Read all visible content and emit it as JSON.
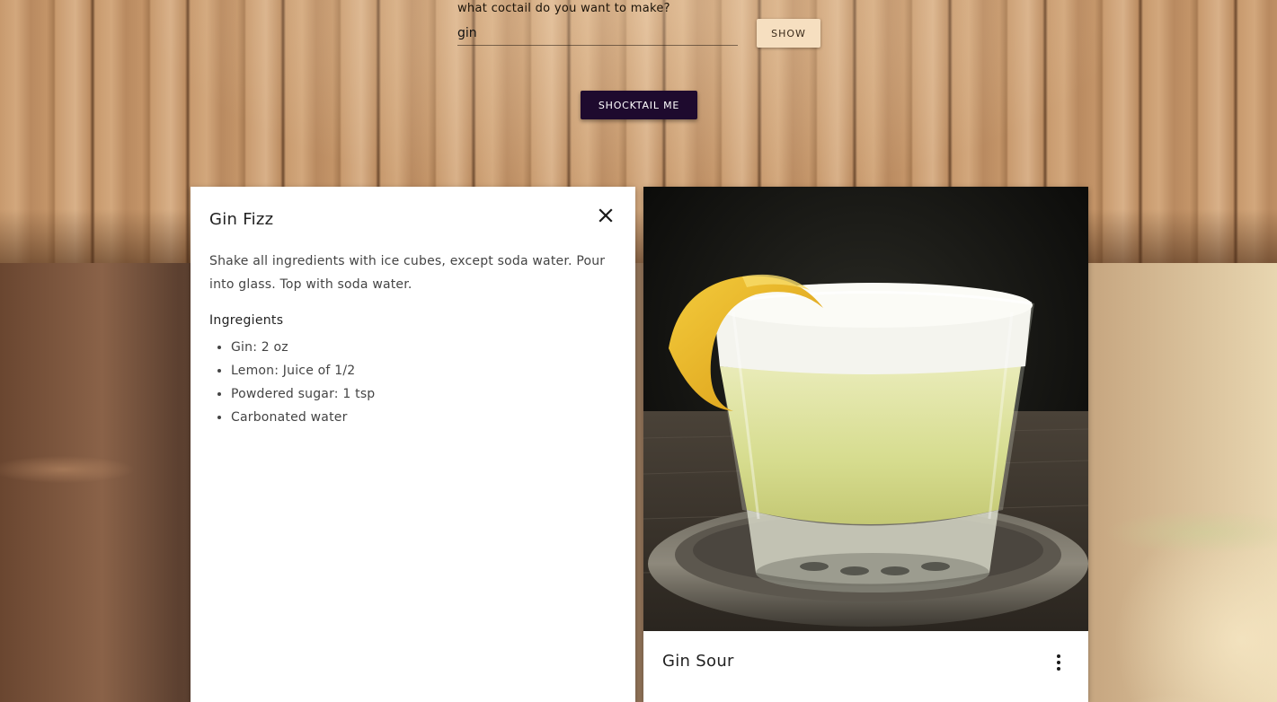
{
  "search": {
    "label": "what coctail do you want to make?",
    "value": "gin",
    "show_label": "Show"
  },
  "actions": {
    "shock_label": "Shocktail me"
  },
  "recipe_card": {
    "title": "Gin Fizz",
    "instructions": "Shake all ingredients with ice cubes, except soda water. Pour into glass. Top with soda water.",
    "ingredients_heading": "Ingregients",
    "ingredients": [
      "Gin: 2 oz",
      "Lemon: Juice of 1/2",
      "Powdered sugar: 1 tsp",
      "Carbonated water"
    ],
    "close_icon": "close-icon"
  },
  "drink_card": {
    "title": "Gin Sour",
    "menu_icon": "more-vert-icon"
  },
  "colors": {
    "show_button_bg": "#f6dfc0",
    "shock_button_bg": "#1e0a2e",
    "card_bg": "#ffffff"
  }
}
